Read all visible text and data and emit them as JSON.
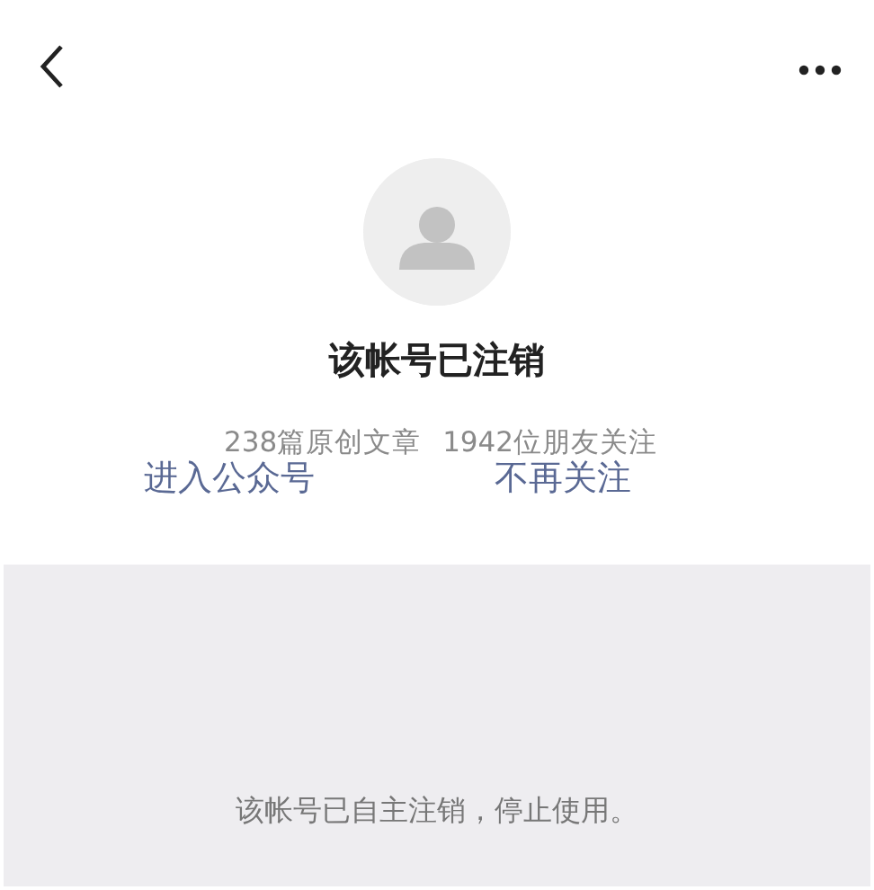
{
  "account": {
    "title": "该帐号已注销",
    "stats": [
      "238篇原创文章",
      "1942位朋友关注"
    ]
  },
  "actions": [
    "进入公众号",
    "不再关注"
  ],
  "notice": "该帐号已自主注销，停止使用。"
}
